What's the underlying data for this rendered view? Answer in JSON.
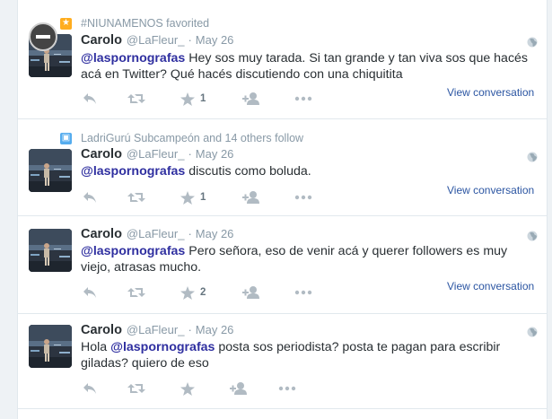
{
  "tweets": [
    {
      "context": {
        "icon": "star-badge-icon",
        "icon_color": "#ffad1f",
        "text": "#NIUNAMENOS favorited"
      },
      "fullname": "Carolo",
      "username": "@LaFleur_",
      "dot": "·",
      "time": "May 26",
      "text_parts": [
        {
          "mention": true,
          "text": "@laspornografas"
        },
        {
          "mention": false,
          "text": " Hey sos muy tarada. Si tan grande y tan viva sos que hacés acá en Twitter? Qué hacés discutiendo con una chiquitita"
        }
      ],
      "favorite_count": "1",
      "view_conversation": "View conversation"
    },
    {
      "context": {
        "icon": "person-badge-icon",
        "icon_color": "#55acee",
        "text": "LadriGurú Subcampeón and 14 others follow"
      },
      "fullname": "Carolo",
      "username": "@LaFleur_",
      "dot": "·",
      "time": "May 26",
      "text_parts": [
        {
          "mention": true,
          "text": "@laspornografas"
        },
        {
          "mention": false,
          "text": " discutis como boluda."
        }
      ],
      "favorite_count": "1",
      "view_conversation": "View conversation"
    },
    {
      "fullname": "Carolo",
      "username": "@LaFleur_",
      "dot": "·",
      "time": "May 26",
      "text_parts": [
        {
          "mention": true,
          "text": "@laspornografas"
        },
        {
          "mention": false,
          "text": " Pero señora, eso de venir acá y querer followers es muy viejo, atrasas mucho."
        }
      ],
      "favorite_count": "2",
      "view_conversation": "View conversation"
    },
    {
      "fullname": "Carolo",
      "username": "@LaFleur_",
      "dot": "·",
      "time": "May 26",
      "text_parts": [
        {
          "mention": false,
          "text": "Hola "
        },
        {
          "mention": true,
          "text": "@laspornografas"
        },
        {
          "mention": false,
          "text": " posta sos periodista? posta te pagan para escribir giladas? quiero de eso"
        }
      ],
      "favorite_count": ""
    }
  ],
  "colors": {
    "mention": "#2f2fa0",
    "link": "#2b55a2",
    "muted": "#8899a6"
  }
}
